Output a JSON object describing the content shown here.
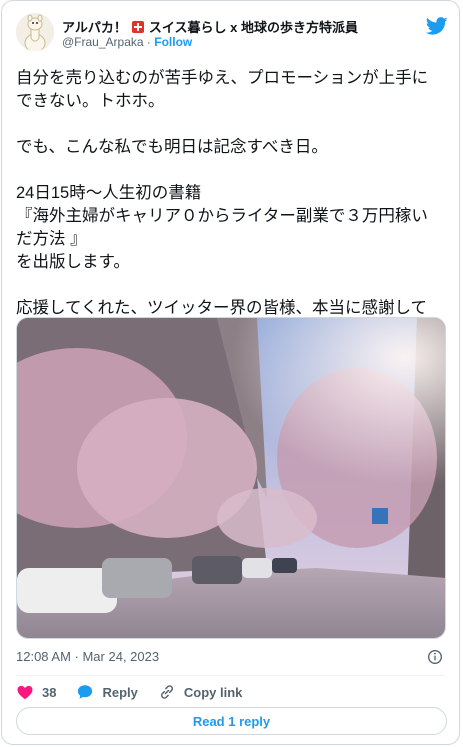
{
  "author": {
    "display_name_part1": "アルパカ！",
    "display_name_part2": "スイス暮らし x 地球の歩き方特派員",
    "handle": "@Frau_Arpaka",
    "separator": "·",
    "follow_label": "Follow"
  },
  "tweet": {
    "text": "自分を売り込むのが苦手ゆえ、プロモーションが上手に\nできない。トホホ。\n\nでも、こんな私でも明日は記念すべき日。\n\n24日15時～人生初の書籍\n『海外主婦がキャリア０からライター副業で３万円稼い\nだ方法 』\nを出版します。\n\n応援してくれた、ツイッター界の皆様、本当に感謝して\nおります。",
    "timestamp": "12:08 AM · Mar 24, 2023"
  },
  "actions": {
    "like_count": "38",
    "reply_label": "Reply",
    "copy_link_label": "Copy link"
  },
  "read_replies_label": "Read 1 reply",
  "colors": {
    "brand_blue": "#1d9bf0",
    "like_red": "#f91880",
    "text": "#0f1419",
    "muted": "#536471"
  },
  "icons": [
    "alpaca-avatar-icon",
    "swiss-flag-icon",
    "twitter-bird-icon",
    "info-icon",
    "heart-icon",
    "reply-bubble-icon",
    "link-icon"
  ]
}
